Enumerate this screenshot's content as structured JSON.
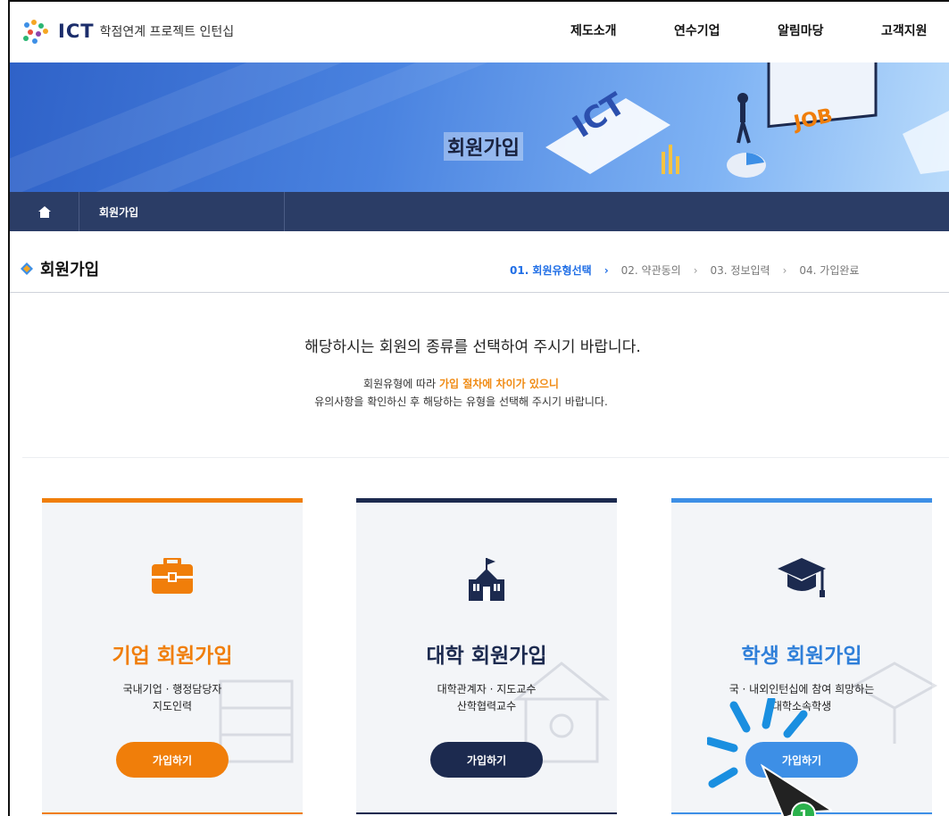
{
  "header": {
    "logo_ict": "ICT",
    "logo_sub": "학점연계 프로젝트 인턴십",
    "nav": [
      "제도소개",
      "연수기업",
      "알림마당",
      "고객지원"
    ]
  },
  "banner": {
    "title": "회원가입",
    "breadcrumb": "회원가입"
  },
  "page": {
    "title": "회원가입",
    "steps": [
      {
        "label": "01. 회원유형선택",
        "active": true
      },
      {
        "label": "02. 약관동의",
        "active": false
      },
      {
        "label": "03. 정보입력",
        "active": false
      },
      {
        "label": "04. 가입완료",
        "active": false
      }
    ]
  },
  "intro": {
    "main": "해당하시는 회원의 종류를 선택하여 주시기 바랍니다.",
    "sub1_prefix": "회원유형에 따라 ",
    "sub1_highlight": "가입 절차에 차이가 있으니",
    "sub2": "유의사항을 확인하신 후 해당하는 유형을 선택해 주시기 바랍니다."
  },
  "cards": [
    {
      "title": "기업 회원가입",
      "desc1": "국내기업 · 행정담당자",
      "desc2": "지도인력",
      "button": "가입하기",
      "icon": "briefcase-icon",
      "color": "#f07e0a"
    },
    {
      "title": "대학 회원가입",
      "desc1": "대학관계자 · 지도교수",
      "desc2": "산학협력교수",
      "button": "가입하기",
      "icon": "school-icon",
      "color": "#1c2a4f"
    },
    {
      "title": "학생 회원가입",
      "desc1": "국 · 내외인턴십에 참여 희망하는",
      "desc2": "대학소속학생",
      "button": "가입하기",
      "icon": "graduation-cap-icon",
      "color": "#3d8fe6"
    }
  ],
  "cursor": {
    "step_number": "1"
  }
}
